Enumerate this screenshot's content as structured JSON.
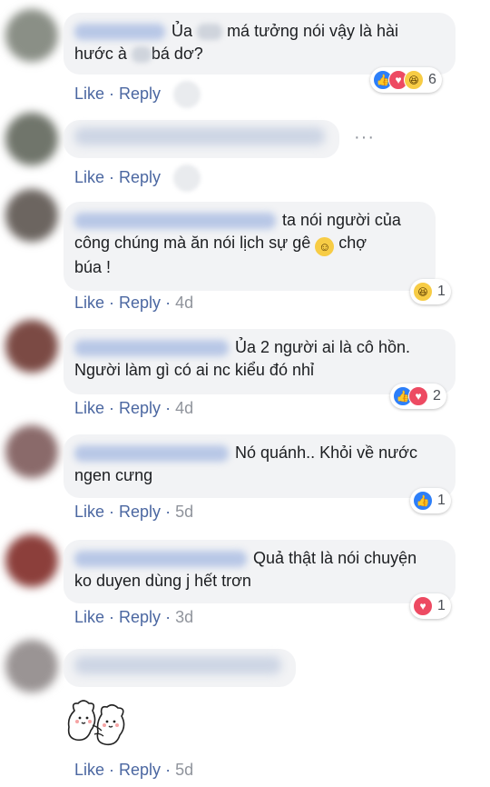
{
  "labels": {
    "like": "Like",
    "reply": "Reply",
    "sep": "·"
  },
  "colors": {
    "link": "#4b67a1",
    "bubble": "#f2f3f5",
    "like": "#2d7ff9",
    "love": "#ed4a62",
    "haha": "#f7cc45"
  },
  "comments": [
    {
      "line1": "Ủa",
      "line1b": "má tưởng nói vậy là hài",
      "line2a": "hước à",
      "line2b": "bá dơ?",
      "time": "",
      "reactions": [
        "like",
        "love",
        "haha"
      ],
      "reaction_count": "6"
    },
    {
      "text": "",
      "time": ""
    },
    {
      "line1": "ta nói người của",
      "line2": "công chúng mà ăn nói lịch sự gê",
      "line2b": "chợ",
      "line3": "búa !",
      "time": "4d",
      "reactions": [
        "haha"
      ],
      "reaction_count": "1"
    },
    {
      "line1": "Ủa 2 người ai là cô hồn.",
      "line2": "Người làm gì có ai nc kiểu đó nhỉ",
      "time": "4d",
      "reactions": [
        "like",
        "love"
      ],
      "reaction_count": "2"
    },
    {
      "line1": "Nó quánh.. Khỏi về nước",
      "line2": "ngen cưng",
      "time": "5d",
      "reactions": [
        "like"
      ],
      "reaction_count": "1"
    },
    {
      "line1": "Quả thật là nói chuyện",
      "line2": "ko duyen dùng j hết trơn",
      "time": "3d",
      "reactions": [
        "love"
      ],
      "reaction_count": "1"
    },
    {
      "text": "",
      "time": "5d",
      "sticker": "hugging-bears-sticker"
    }
  ]
}
